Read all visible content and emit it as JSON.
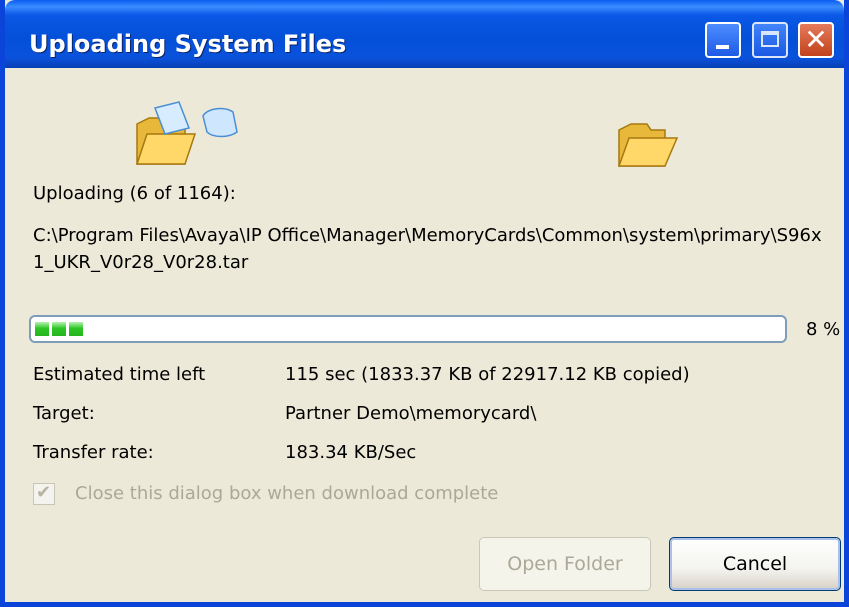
{
  "window": {
    "title": "Uploading System Files",
    "controls": {
      "minimize": "minimize-icon",
      "maximize": "maximize-icon",
      "close": "close-icon"
    }
  },
  "icons": {
    "source": "folder-with-flying-page-icon",
    "destination": "open-folder-icon"
  },
  "status": {
    "uploading": "Uploading (6 of 1164):",
    "path": "C:\\Program Files\\Avaya\\IP Office\\Manager\\MemoryCards\\Common\\system\\primary\\S96x1_UKR_V0r28_V0r28.tar"
  },
  "progress": {
    "percent_value": 8,
    "percent_text": "8 %"
  },
  "details": {
    "time_left_label": "Estimated time left",
    "time_left_value": "115 sec (1833.37 KB of 22917.12 KB copied)",
    "target_label": "Target:",
    "target_value": "Partner Demo\\memorycard\\",
    "rate_label": "Transfer rate:",
    "rate_value": "183.34 KB/Sec"
  },
  "checkbox": {
    "label": "Close this dialog box when download complete",
    "checked": true,
    "enabled": false
  },
  "buttons": {
    "open_folder": "Open Folder",
    "cancel": "Cancel"
  },
  "colors": {
    "titlebar": "#0a52dc",
    "progress_fill": "#2ec527",
    "background": "#ece9d8"
  }
}
